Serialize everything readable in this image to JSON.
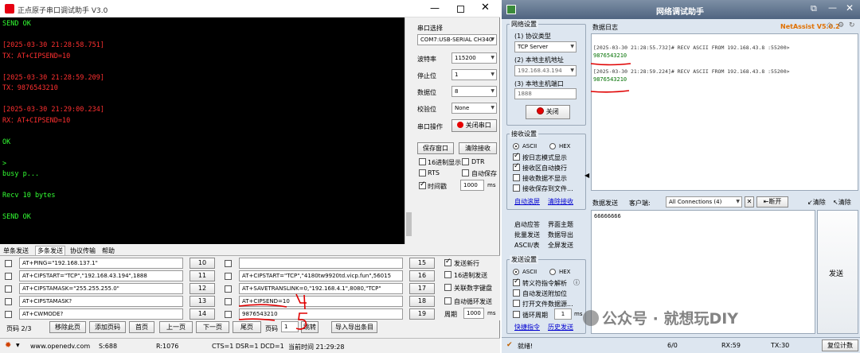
{
  "left_window": {
    "title": "正点原子串口调试助手 V3.0",
    "terminal_lines": [
      {
        "text": "SEND OK",
        "color": "#33ff33"
      },
      {
        "text": "",
        "color": "#33ff33"
      },
      {
        "text": "[2025-03-30 21:28:58.751]",
        "color": "#ff3030"
      },
      {
        "text": "TX：AT+CIPSEND=10",
        "color": "#ff3030"
      },
      {
        "text": "",
        "color": "#33ff33"
      },
      {
        "text": "[2025-03-30 21:28:59.209]",
        "color": "#ff3030"
      },
      {
        "text": "TX：9876543210",
        "color": "#ff3030"
      },
      {
        "text": "",
        "color": "#33ff33"
      },
      {
        "text": "[2025-03-30 21:29:00.234]",
        "color": "#ff3030"
      },
      {
        "text": "RX：AT+CIPSEND=10",
        "color": "#ff3030"
      },
      {
        "text": "",
        "color": "#33ff33"
      },
      {
        "text": "OK",
        "color": "#33ff33"
      },
      {
        "text": "",
        "color": "#33ff33"
      },
      {
        "text": ">",
        "color": "#33ff33"
      },
      {
        "text": "busy p...",
        "color": "#33ff33"
      },
      {
        "text": "",
        "color": "#33ff33"
      },
      {
        "text": "Recv 10 bytes",
        "color": "#33ff33"
      },
      {
        "text": "",
        "color": "#33ff33"
      },
      {
        "text": "SEND OK",
        "color": "#33ff33"
      }
    ],
    "serial": {
      "select_label": "串口选择",
      "port": "COM7:USB-SERIAL CH340",
      "baud_label": "波特率",
      "baud": "115200",
      "stop_label": "停止位",
      "stop": "1",
      "data_label": "数据位",
      "data": "8",
      "parity_label": "校验位",
      "parity": "None",
      "op_label": "串口操作",
      "close_btn": "关闭串口",
      "save_btn": "保存窗口",
      "clear_btn": "清除接收",
      "hex_display": "16进制显示",
      "dtr": "DTR",
      "rts": "RTS",
      "auto_save": "自动保存",
      "timestamp": "时间戳",
      "ts_value": "1000",
      "ts_unit": "ms"
    },
    "tabs": [
      "单条发送",
      "多条发送",
      "协议传输",
      "帮助"
    ],
    "multi_send_left": [
      {
        "cmd": "AT+PING=\"192.168.137.1\"",
        "num": "10"
      },
      {
        "cmd": "AT+CIPSTART=\"TCP\",\"192.168.43.194\",1888",
        "num": "11"
      },
      {
        "cmd": "AT+CIPSTAMASK=\"255.255.255.0\"",
        "num": "12"
      },
      {
        "cmd": "AT+CIPSTAMASK?",
        "num": "13"
      },
      {
        "cmd": "AT+CWMODE?",
        "num": "14"
      }
    ],
    "multi_send_right": [
      {
        "cmd": "",
        "num": "15"
      },
      {
        "cmd": "AT+CIPSTART=\"TCP\",\"4180tw9920td.vicp.fun\",56015",
        "num": "16"
      },
      {
        "cmd": "AT+SAVETRANSLINK=0,\"192.168.4.1\",8080,\"TCP\"",
        "num": "17"
      },
      {
        "cmd": "AT+CIPSEND=10",
        "num": "18"
      },
      {
        "cmd": "9876543210",
        "num": "19"
      }
    ],
    "send_options": {
      "newline": "发送新行",
      "hex_send": "16进制发送",
      "assoc_kb": "关联数字键盘",
      "loop_send": "自动循环发送",
      "period_label": "周期",
      "period": "1000",
      "period_unit": "ms"
    },
    "pager": {
      "page_label": "页码 2/3",
      "move": "移除此页",
      "add": "添加页码",
      "first": "首页",
      "prev": "上一页",
      "next": "下一页",
      "last": "尾页",
      "goto_label": "页码",
      "goto_value": "1",
      "jump": "跳转",
      "import": "导入导出条目"
    },
    "status": {
      "url": "www.openedv.com",
      "s": "S:688",
      "r": "R:1076",
      "signals": "CTS=1 DSR=1 DCD=1",
      "time": "当前时间 21:29:28"
    },
    "annotations": [
      "4",
      "5"
    ]
  },
  "right_window": {
    "title": "网络调试助手",
    "brand": "NetAssist V5.0.2",
    "net_settings": {
      "group": "网络设置",
      "protocol_label": "(1) 协议类型",
      "protocol": "TCP Server",
      "host_label": "(2) 本地主机地址",
      "host": "192.168.43.194",
      "port_label": "(3) 本地主机端口",
      "port": "1888",
      "close_btn": "关闭"
    },
    "recv_settings": {
      "group": "接收设置",
      "ascii": "ASCII",
      "hex": "HEX",
      "opt1": "按日志模式显示",
      "opt2": "接收区自动换行",
      "opt3": "接收数据不显示",
      "opt4": "接收保存到文件...",
      "link1": "自动滚屏",
      "link2": "清除接收"
    },
    "side_links": [
      "启动应答",
      "界面主题",
      "批量发送",
      "数据导出",
      "ASCII/表",
      "全屏发送"
    ],
    "send_settings": {
      "group": "发送设置",
      "ascii": "ASCII",
      "hex": "HEX",
      "opt1": "转义符指令解析",
      "opt2": "自动发送附加位",
      "opt3": "打开文件数据源...",
      "opt4": "循环周期",
      "period": "1",
      "unit": "ms",
      "link1": "快捷指令",
      "link2": "历史发送"
    },
    "log_title": "数据日志",
    "log": [
      {
        "head": "[2025-03-30 21:28:55.732]# RECV ASCII FROM 192.168.43.8 :55200>",
        "body": "9876543210"
      },
      {
        "head": "[2025-03-30 21:28:59.224]# RECV ASCII FROM 192.168.43.8 :55200>",
        "body": "9876543210"
      }
    ],
    "send_bar": {
      "label": "数据发送",
      "client_label": "客户端:",
      "client": "All Connections (4)",
      "disconnect": "断开",
      "clear1": "清除",
      "clear2": "清除"
    },
    "send_text": "66666666",
    "send_btn": "发送",
    "status": {
      "ready": "就绪!",
      "count": "6/0",
      "rx": "RX:59",
      "tx": "TX:30",
      "reset": "复位计数"
    }
  },
  "watermark": "公众号 · 就想玩DIY"
}
